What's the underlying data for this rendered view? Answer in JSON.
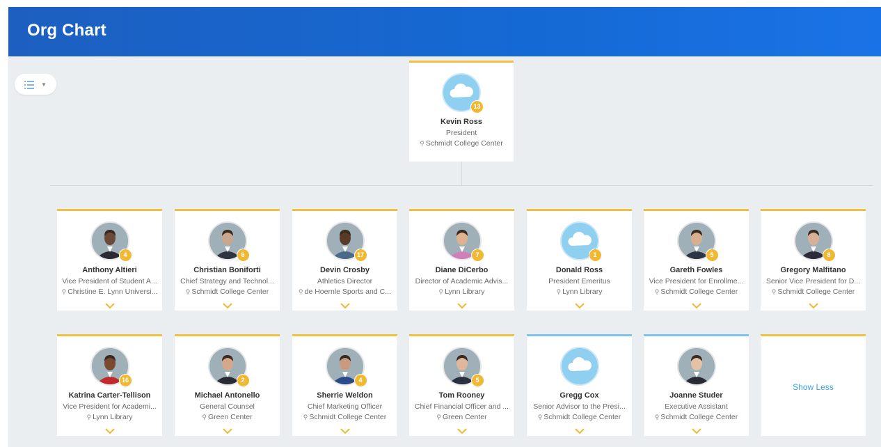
{
  "header": {
    "title": "Org Chart"
  },
  "toolbar": {
    "view_icon": "list-view-icon",
    "dropdown_icon": "chevron-down-icon"
  },
  "top": {
    "name": "Kevin Ross",
    "title": "President",
    "location": "Schmidt College Center",
    "count": "13",
    "avatar": "cloud"
  },
  "row1": [
    {
      "name": "Anthony Altieri",
      "title": "Vice President of Student A...",
      "location": "Christine E. Lynn Universi...",
      "count": "4",
      "avatar": "photo",
      "tone": "#6b4a3a",
      "suit": "#2a2a33"
    },
    {
      "name": "Christian Boniforti",
      "title": "Chief Strategy and Technol...",
      "location": "Schmidt College Center",
      "count": "6",
      "avatar": "photo",
      "tone": "#c9a78c",
      "suit": "#2f3440"
    },
    {
      "name": "Devin Crosby",
      "title": "Athletics Director",
      "location": "de Hoernle Sports and C...",
      "count": "17",
      "avatar": "photo",
      "tone": "#5a3a2a",
      "suit": "#4a6a8a"
    },
    {
      "name": "Diane DiCerbo",
      "title": "Director of Academic Advis...",
      "location": "Lynn Library",
      "count": "7",
      "avatar": "photo",
      "tone": "#e0b28f",
      "suit": "#d080b8"
    },
    {
      "name": "Donald Ross",
      "title": "President Emeritus",
      "location": "Lynn Library",
      "count": "1",
      "avatar": "cloud"
    },
    {
      "name": "Gareth Fowles",
      "title": "Vice President for Enrollme...",
      "location": "Schmidt College Center",
      "count": "5",
      "avatar": "photo",
      "tone": "#d8b08e",
      "suit": "#2b3545"
    },
    {
      "name": "Gregory Malfitano",
      "title": "Senior Vice President for D...",
      "location": "Schmidt College Center",
      "count": "8",
      "avatar": "photo",
      "tone": "#d7b097",
      "suit": "#2b2b3a"
    }
  ],
  "row2": [
    {
      "name": "Katrina Carter-Tellison",
      "title": "Vice President for Academi...",
      "location": "Lynn Library",
      "count": "16",
      "avatar": "photo",
      "tone": "#7a4a30",
      "suit": "#c02a2a"
    },
    {
      "name": "Michael Antonello",
      "title": "General Counsel",
      "location": "Green Center",
      "count": "2",
      "avatar": "photo",
      "tone": "#d3a98a",
      "suit": "#2a2a33"
    },
    {
      "name": "Sherrie Weldon",
      "title": "Chief Marketing Officer",
      "location": "Schmidt College Center",
      "count": "4",
      "avatar": "photo",
      "tone": "#c89a80",
      "suit": "#2a4a8a"
    },
    {
      "name": "Tom Rooney",
      "title": "Chief Financial Officer and ...",
      "location": "Green Center",
      "count": "5",
      "avatar": "photo",
      "tone": "#e0b79a",
      "suit": "#2a3040"
    },
    {
      "name": "Gregg Cox",
      "title": "Senior Advisor to the Presi...",
      "location": "Schmidt College Center",
      "count": "",
      "avatar": "cloud"
    },
    {
      "name": "Joanne Studer",
      "title": "Executive Assistant",
      "location": "Schmidt College Center",
      "count": "",
      "avatar": "photo",
      "tone": "#e3c2a6",
      "suit": "#2a2a33"
    }
  ],
  "show_less_label": "Show Less",
  "colors": {
    "header": "#1a6ad6",
    "accent_gold": "#f1c040",
    "accent_blue": "#7ec3ef",
    "link": "#3aa0e0",
    "background": "#ebeef0"
  }
}
